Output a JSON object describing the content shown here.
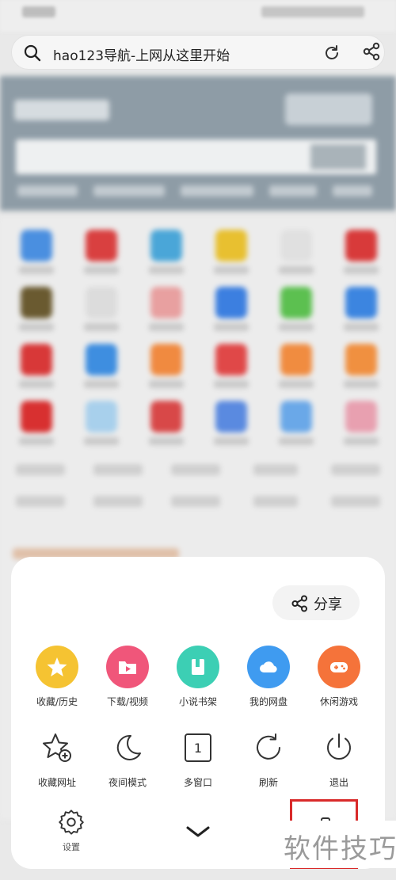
{
  "search": {
    "url_title": "hao123导航-上网从这里开始",
    "icon": "search-icon"
  },
  "sheet": {
    "share_label": "分享",
    "row1": [
      {
        "label": "收藏/历史",
        "icon": "star-icon",
        "color": "#f5c332"
      },
      {
        "label": "下载/视频",
        "icon": "folder-play-icon",
        "color": "#f0567a"
      },
      {
        "label": "小说书架",
        "icon": "book-icon",
        "color": "#3ccfb4"
      },
      {
        "label": "我的网盘",
        "icon": "cloud-icon",
        "color": "#3f9bf0"
      },
      {
        "label": "休闲游戏",
        "icon": "gamepad-icon",
        "color": "#f5733a"
      }
    ],
    "row2": [
      {
        "label": "收藏网址",
        "icon": "star-add-icon"
      },
      {
        "label": "夜间模式",
        "icon": "moon-icon"
      },
      {
        "label": "多窗口",
        "icon": "window-count-icon",
        "count": "1"
      },
      {
        "label": "刷新",
        "icon": "refresh-icon"
      },
      {
        "label": "退出",
        "icon": "power-icon"
      }
    ],
    "settings_label": "设置"
  },
  "watermark": "软件技巧"
}
